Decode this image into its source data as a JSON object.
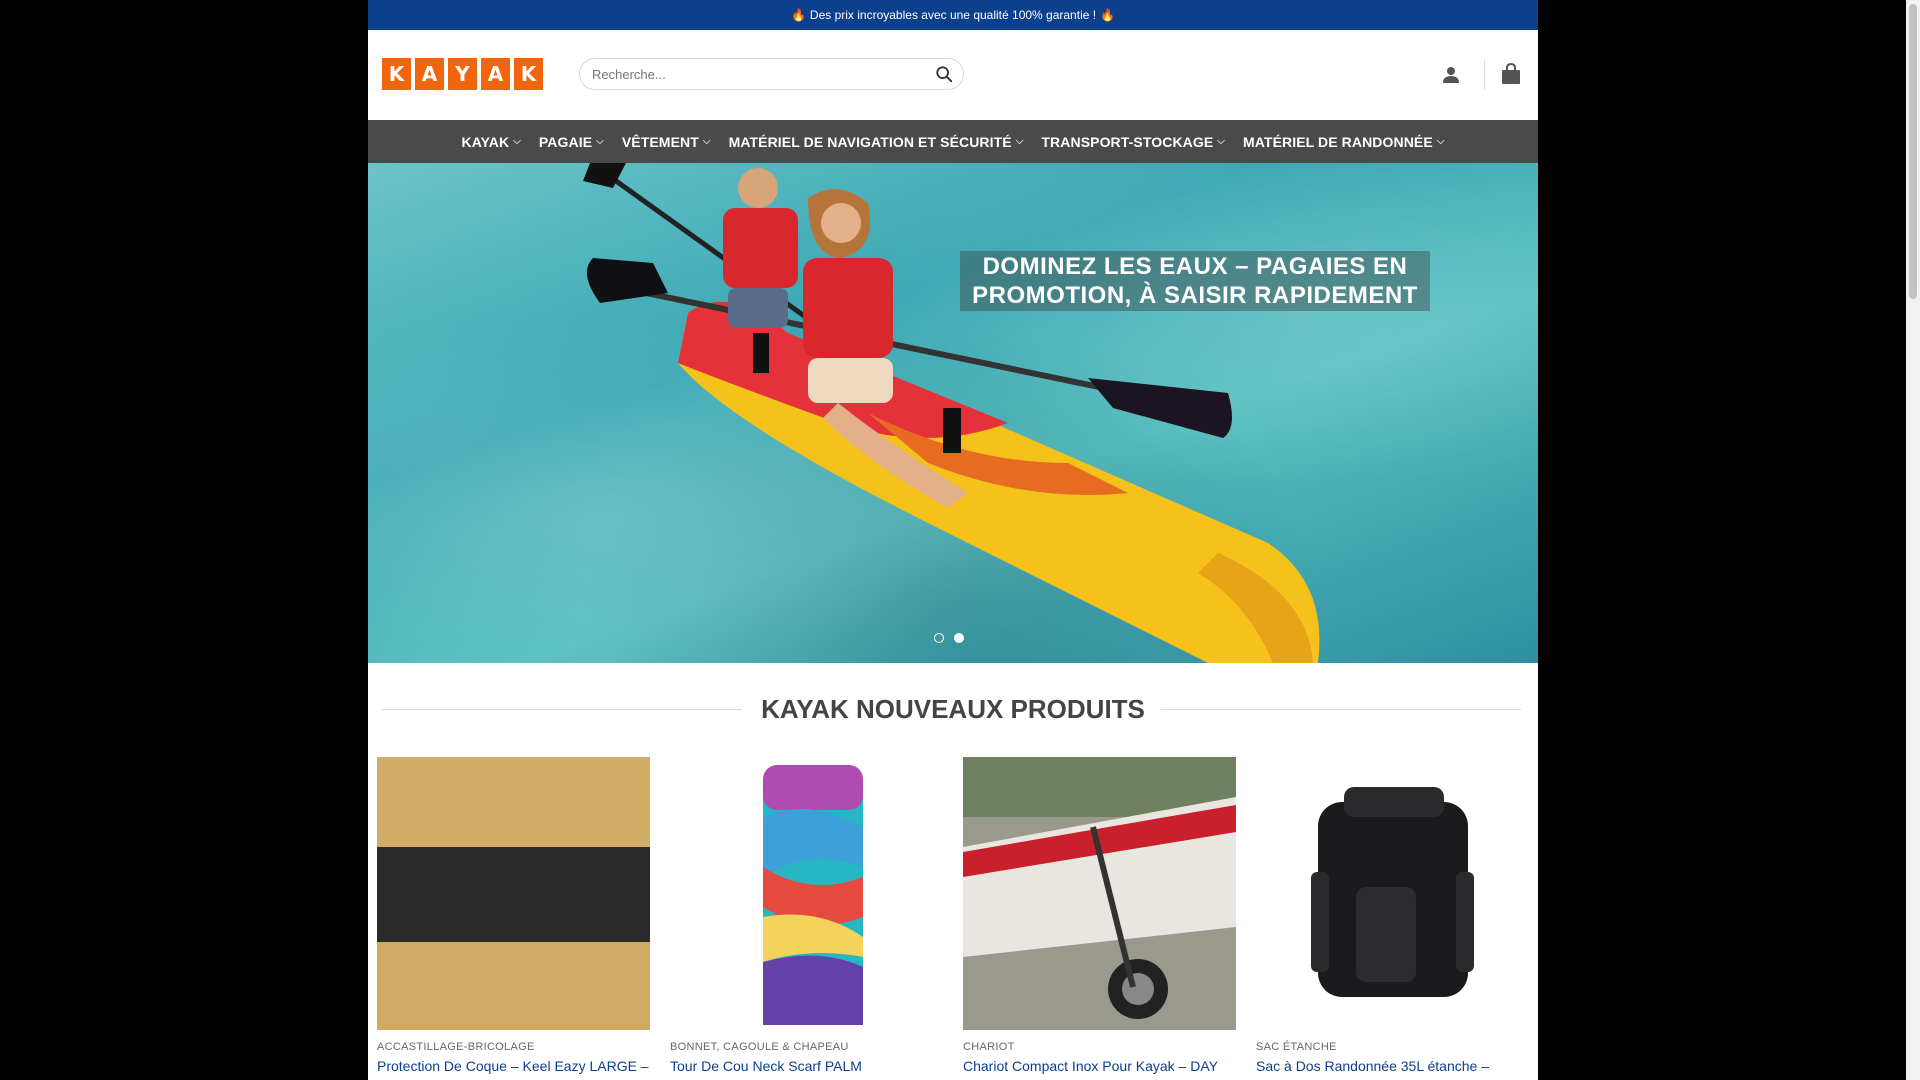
{
  "topbar": {
    "text": "Des prix incroyables avec une qualité 100% garantie !",
    "flame": "🔥"
  },
  "logo": {
    "letters": [
      "K",
      "A",
      "Y",
      "A",
      "K"
    ]
  },
  "search": {
    "placeholder": "Recherche..."
  },
  "nav": {
    "items": [
      {
        "label": "KAYAK"
      },
      {
        "label": "PAGAIE"
      },
      {
        "label": "VÊTEMENT"
      },
      {
        "label": "MATÉRIEL DE NAVIGATION ET SÉCURITÉ"
      },
      {
        "label": "TRANSPORT-STOCKAGE"
      },
      {
        "label": "MATÉRIEL DE RANDONNÉE"
      }
    ]
  },
  "hero": {
    "title": "DOMINEZ LES EAUX – PAGAIES EN PROMOTION, À SAISIR RAPIDEMENT",
    "slide_count": 2,
    "active_slide": 2
  },
  "section": {
    "title": "KAYAK NOUVEAUX PRODUITS"
  },
  "products": [
    {
      "category": "ACCASTILLAGE-BRICOLAGE",
      "name": "Protection De Coque – Keel Eazy LARGE –"
    },
    {
      "category": "BONNET, CAGOULE & CHAPEAU",
      "name": "Tour De Cou Neck Scarf PALM"
    },
    {
      "category": "CHARIOT",
      "name": "Chariot Compact Inox Pour Kayak – DAY"
    },
    {
      "category": "SAC ÉTANCHE",
      "name": "Sac à Dos Randonnée 35L étanche –"
    }
  ],
  "colors": {
    "brand": "#f2650d",
    "topbar": "#0c3f8c",
    "nav": "#4a4a4a",
    "link": "#0c3f8c"
  }
}
